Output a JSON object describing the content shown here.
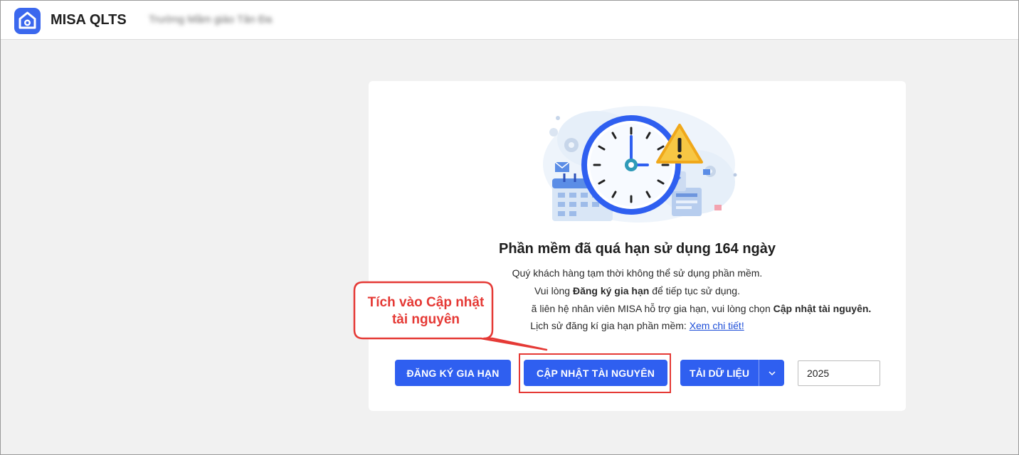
{
  "header": {
    "app_name": "MISA QLTS",
    "org_name": "Trường Mầm giáo Tân Đa"
  },
  "notice": {
    "headline": "Phần mềm đã quá hạn sử dụng 164 ngày",
    "line1": "Quý khách hàng tạm thời không thể sử dụng phần mềm.",
    "line2_prefix": "Vui lòng ",
    "line2_bold": "Đăng ký gia hạn",
    "line2_suffix": " để tiếp tục sử dụng.",
    "line3_prefix": "ã liên hệ nhân viên MISA hỗ trợ gia hạn, vui lòng chọn ",
    "line3_bold": "Cập nhật tài nguyên.",
    "line4_prefix": "Lịch sử đăng kí gia hạn phần mềm: ",
    "line4_link": "Xem chi tiết!"
  },
  "actions": {
    "register_label": "ĐĂNG KÝ GIA HẠN",
    "update_label": "CẬP NHẬT TÀI NGUYÊN",
    "download_label": "TẢI DỮ LIỆU",
    "year_value": "2025"
  },
  "annotation": {
    "callout_text": "Tích vào Cập nhật tài nguyên"
  },
  "colors": {
    "primary": "#2f5ff0",
    "annotation_red": "#e53935",
    "logo_blue": "#3b68ee"
  },
  "icons": [
    "home-logo-icon",
    "clock-icon",
    "warning-icon",
    "gear-icon",
    "mail-icon",
    "calendar-icon",
    "chevron-down-icon"
  ]
}
